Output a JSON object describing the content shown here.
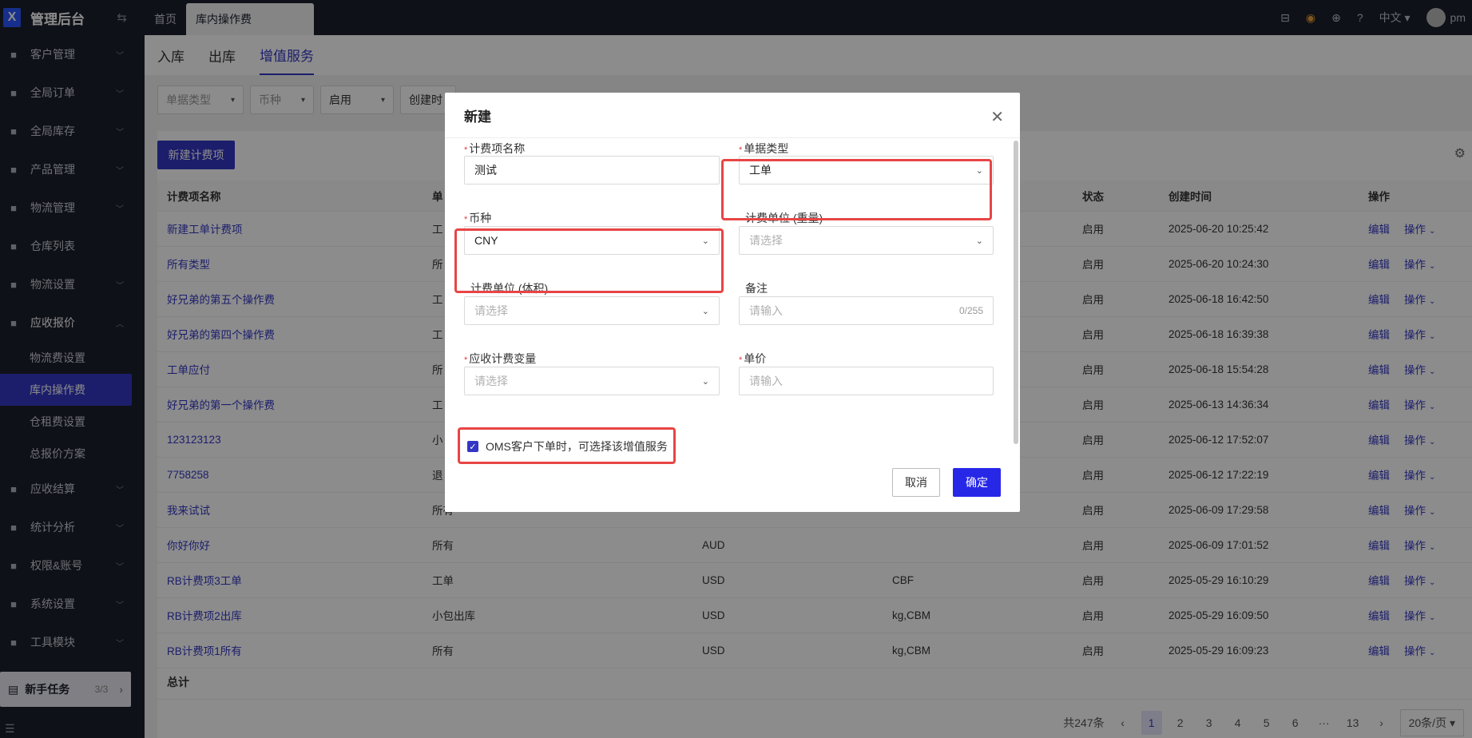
{
  "app": {
    "title": "管理后台",
    "collapse_icon": "collapse-icon"
  },
  "sidebar": {
    "items": [
      {
        "label": "客户管理",
        "icon": "users-icon"
      },
      {
        "label": "全局订单",
        "icon": "order-icon"
      },
      {
        "label": "全局库存",
        "icon": "warehouse-icon"
      },
      {
        "label": "产品管理",
        "icon": "box-icon"
      },
      {
        "label": "物流管理",
        "icon": "truck-icon"
      },
      {
        "label": "仓库列表",
        "icon": "store-icon"
      },
      {
        "label": "物流设置",
        "icon": "gear-icon"
      },
      {
        "label": "应收报价",
        "icon": "doc-icon"
      }
    ],
    "sub_items": [
      "物流费设置",
      "库内操作费",
      "仓租费设置",
      "总报价方案"
    ],
    "items_after": [
      {
        "label": "应收结算",
        "icon": "coin-icon"
      },
      {
        "label": "统计分析",
        "icon": "chart-icon"
      },
      {
        "label": "权限&账号",
        "icon": "org-icon"
      },
      {
        "label": "系统设置",
        "icon": "settings-icon"
      },
      {
        "label": "工具模块",
        "icon": "tool-icon"
      }
    ],
    "task": {
      "label": "新手任务",
      "count": "3/3"
    }
  },
  "topbar": {
    "tabs": [
      "首页",
      "库内操作费"
    ],
    "language": "中文",
    "user": "pm"
  },
  "subtabs": [
    "入库",
    "出库",
    "增值服务"
  ],
  "filters": [
    "单据类型",
    "币种",
    "启用",
    "创建时"
  ],
  "panel": {
    "new_button": "新建计费项",
    "columns": [
      "计费项名称",
      "单",
      "状态",
      "创建时间",
      "操作"
    ],
    "rows": [
      {
        "name": "新建工单计费项",
        "type": "工",
        "currency": "",
        "unit": "",
        "status": "启用",
        "time": "2025-06-20 10:25:42"
      },
      {
        "name": "所有类型",
        "type": "所",
        "currency": "",
        "unit": "",
        "status": "启用",
        "time": "2025-06-20 10:24:30"
      },
      {
        "name": "好兄弟的第五个操作费",
        "type": "工",
        "currency": "",
        "unit": "",
        "status": "启用",
        "time": "2025-06-18 16:42:50"
      },
      {
        "name": "好兄弟的第四个操作费",
        "type": "工",
        "currency": "",
        "unit": "",
        "status": "启用",
        "time": "2025-06-18 16:39:38"
      },
      {
        "name": "工单应付",
        "type": "所",
        "currency": "",
        "unit": "",
        "status": "启用",
        "time": "2025-06-18 15:54:28"
      },
      {
        "name": "好兄弟的第一个操作费",
        "type": "工",
        "currency": "",
        "unit": "",
        "status": "启用",
        "time": "2025-06-13 14:36:34"
      },
      {
        "name": "123123123",
        "type": "小",
        "currency": "",
        "unit": "",
        "status": "启用",
        "time": "2025-06-12 17:52:07"
      },
      {
        "name": "7758258",
        "type": "退",
        "currency": "",
        "unit": "",
        "status": "启用",
        "time": "2025-06-12 17:22:19"
      },
      {
        "name": "我来试试",
        "type": "所有",
        "currency": "",
        "unit": "",
        "status": "启用",
        "time": "2025-06-09 17:29:58"
      },
      {
        "name": "你好你好",
        "type": "所有",
        "currency": "AUD",
        "unit": "",
        "status": "启用",
        "time": "2025-06-09 17:01:52"
      },
      {
        "name": "RB计费项3工单",
        "type": "工单",
        "currency": "USD",
        "unit": "CBF",
        "status": "启用",
        "time": "2025-05-29 16:10:29"
      },
      {
        "name": "RB计费项2出库",
        "type": "小包出库",
        "currency": "USD",
        "unit": "kg,CBM",
        "status": "启用",
        "time": "2025-05-29 16:09:50"
      },
      {
        "name": "RB计费项1所有",
        "type": "所有",
        "currency": "USD",
        "unit": "kg,CBM",
        "status": "启用",
        "time": "2025-05-29 16:09:23"
      }
    ],
    "edit_label": "编辑",
    "ops_label": "操作",
    "total_label": "总计",
    "pager": {
      "total": "共247条",
      "pages": [
        "1",
        "2",
        "3",
        "4",
        "5",
        "6",
        "···",
        "13"
      ],
      "size": "20条/页"
    }
  },
  "modal": {
    "title": "新建",
    "name_label": "计费项名称",
    "name_value": "测试",
    "doc_type_label": "单据类型",
    "doc_type_value": "工单",
    "currency_label": "币种",
    "currency_value": "CNY",
    "weight_unit_label": "计费单位 (重量)",
    "weight_unit_placeholder": "请选择",
    "volume_unit_label": "计费单位 (体积)",
    "volume_unit_placeholder": "请选择",
    "remark_label": "备注",
    "remark_placeholder": "请输入",
    "remark_count": "0/255",
    "variable_label": "应收计费变量",
    "variable_placeholder": "请选择",
    "price_label": "单价",
    "price_placeholder": "请输入",
    "checkbox_label": "OMS客户下单时，可选择该增值服务",
    "checkbox_checked": true,
    "cancel": "取消",
    "ok": "确定"
  },
  "colors": {
    "accent": "#3437c4",
    "sidebar_bg": "#1c1f2c",
    "highlight": "#e84545",
    "ok_button": "#2727e8"
  }
}
